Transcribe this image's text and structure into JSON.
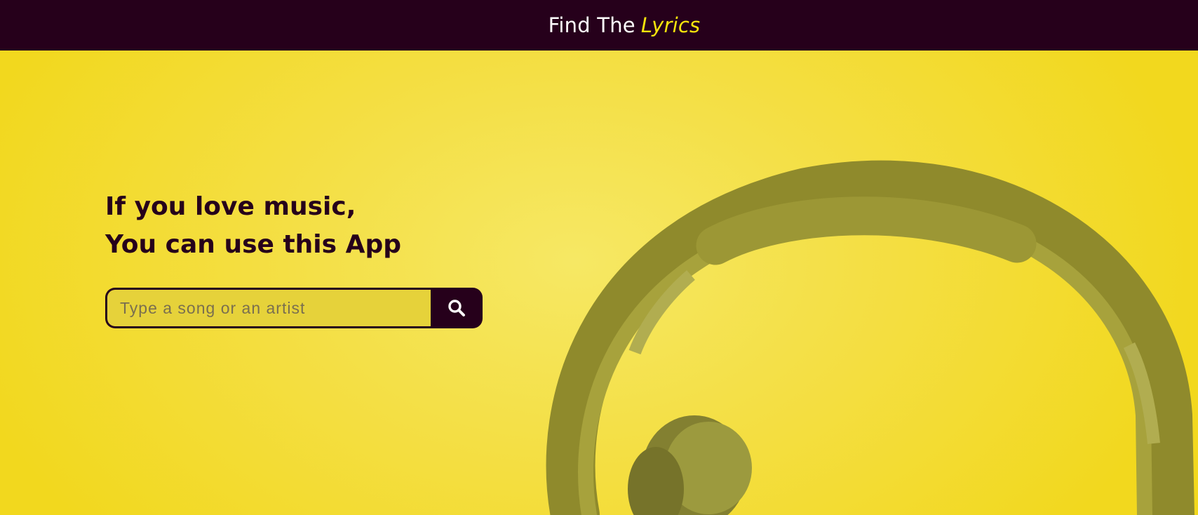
{
  "header": {
    "brand_prefix": "Find The",
    "brand_accent": "Lyrics"
  },
  "hero": {
    "headline_line1": "If you love music,",
    "headline_line2": "You can use this App",
    "image_subject": "headphones"
  },
  "search": {
    "placeholder": "Type a song or an artist",
    "value": "",
    "button_icon": "search-icon"
  },
  "colors": {
    "header_bg": "#26001b",
    "accent": "#f6e40c",
    "hero_bg": "#f4d82a",
    "text_dark": "#26001b"
  }
}
